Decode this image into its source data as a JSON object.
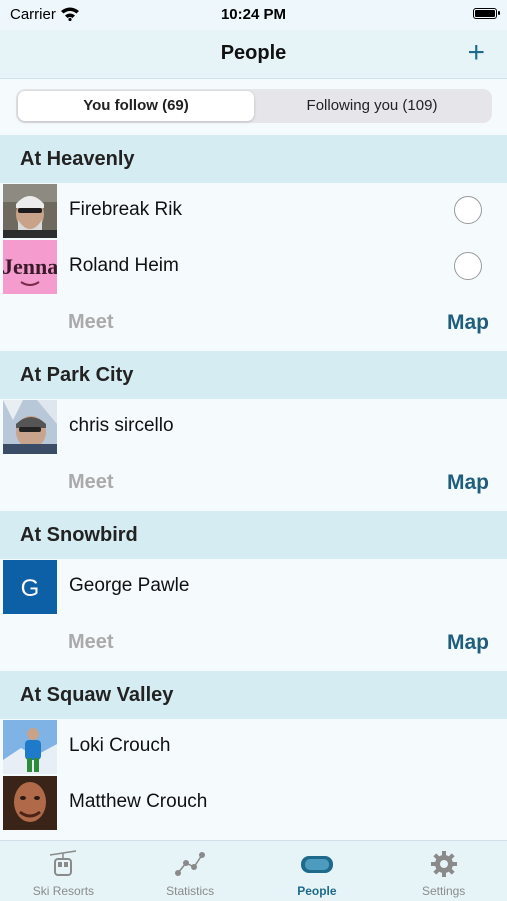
{
  "status": {
    "carrier": "Carrier",
    "time": "10:24 PM"
  },
  "navbar": {
    "title": "People",
    "add_label": "+"
  },
  "segments": [
    {
      "label": "You follow (69)",
      "selected": true
    },
    {
      "label": "Following you (109)",
      "selected": false
    }
  ],
  "sections": [
    {
      "header": "At Heavenly",
      "people": [
        {
          "name": "Firebreak Rik"
        },
        {
          "name": "Roland Heim",
          "avatar_text": "Jenna"
        }
      ],
      "meet": "Meet",
      "map": "Map"
    },
    {
      "header": "At Park City",
      "people": [
        {
          "name": "chris sircello"
        }
      ],
      "meet": "Meet",
      "map": "Map"
    },
    {
      "header": "At Snowbird",
      "people": [
        {
          "name": "George Pawle",
          "avatar_letter": "G"
        }
      ],
      "meet": "Meet",
      "map": "Map"
    },
    {
      "header": "At Squaw Valley",
      "people": [
        {
          "name": "Loki Crouch"
        },
        {
          "name": "Matthew Crouch"
        }
      ]
    }
  ],
  "tabs": [
    {
      "label": "Ski Resorts",
      "icon": "gondola-icon"
    },
    {
      "label": "Statistics",
      "icon": "statistics-icon"
    },
    {
      "label": "People",
      "icon": "goggles-icon",
      "active": true
    },
    {
      "label": "Settings",
      "icon": "gear-icon"
    }
  ],
  "colors": {
    "accent": "#1f6a8a",
    "section_bg": "#d5ecf3",
    "nav_bg": "#e6f4f8"
  }
}
